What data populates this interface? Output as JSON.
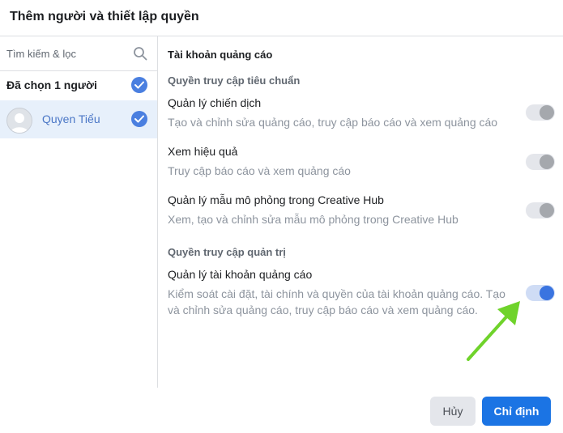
{
  "dialog": {
    "title": "Thêm người và thiết lập quyền"
  },
  "left_panel": {
    "search_placeholder": "Tìm kiếm & lọc",
    "selected_count": "Đã chọn 1 người",
    "user_name": "Quyen Tiểu"
  },
  "right_panel": {
    "section_title": "Tài khoản quảng cáo",
    "standard_group": "Quyền truy cập tiêu chuẩn",
    "admin_group": "Quyền truy cập quản trị",
    "permissions": [
      {
        "name": "Quản lý chiến dịch",
        "desc": "Tạo và chỉnh sửa quảng cáo, truy cập báo cáo và xem quảng cáo",
        "enabled": false
      },
      {
        "name": "Xem hiệu quả",
        "desc": "Truy cập báo cáo và xem quảng cáo",
        "enabled": false
      },
      {
        "name": "Quản lý mẫu mô phỏng trong Creative Hub",
        "desc": "Xem, tạo và chỉnh sửa mẫu mô phỏng trong Creative Hub",
        "enabled": false
      },
      {
        "name": "Quản lý tài khoản quảng cáo",
        "desc": "Kiểm soát cài đặt, tài chính và quyền của tài khoản quảng cáo. Tạo và chỉnh sửa quảng cáo, truy cập báo cáo và xem quảng cáo.",
        "enabled": true
      }
    ]
  },
  "footer": {
    "cancel_label": "Hủy",
    "assign_label": "Chỉ định"
  },
  "colors": {
    "accent": "#1b74e4",
    "toggle_on": "#3a74e0",
    "arrow": "#6fd32b"
  }
}
